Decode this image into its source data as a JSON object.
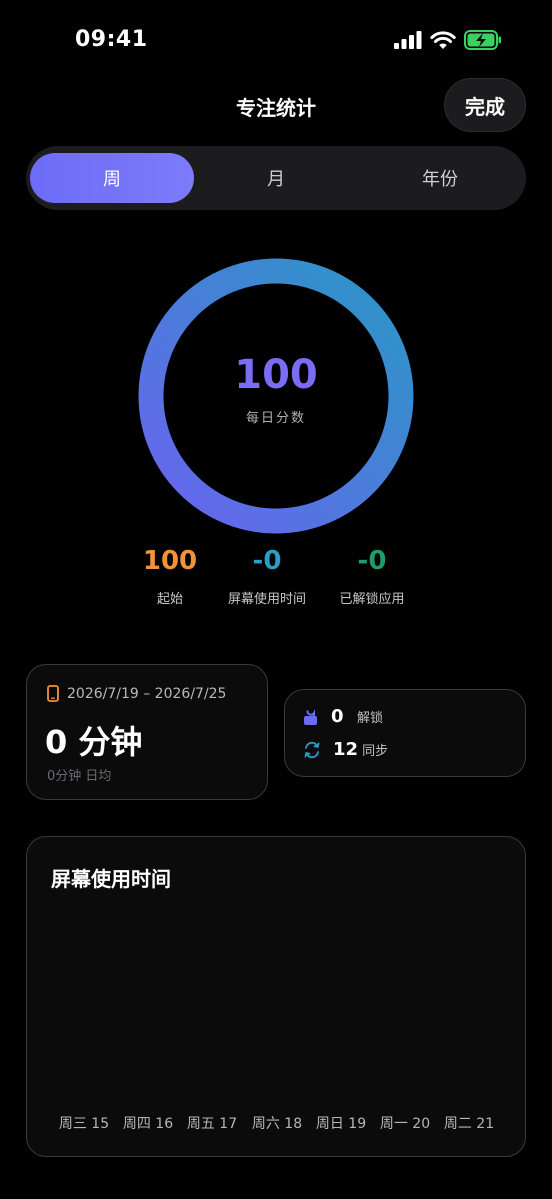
{
  "status_bar": {
    "time": "09:41"
  },
  "header": {
    "title": "专注统计",
    "done_label": "完成"
  },
  "segments": [
    "周",
    "月",
    "年份"
  ],
  "ring": {
    "score": "100",
    "label": "每日分数",
    "colors": {
      "start": "#6a63f0",
      "end": "#2a97c4"
    }
  },
  "stats": [
    {
      "value": "100",
      "label": "起始",
      "color": "#f0913b"
    },
    {
      "value": "-0",
      "label": "屏幕使用时间",
      "color": "#2b9dc6"
    },
    {
      "value": "-0",
      "label": "已解锁应用",
      "color": "#1e9c6c"
    }
  ],
  "range_card": {
    "range": "2026/7/19 – 2026/7/25",
    "total": "0 分钟",
    "average": "0分钟 日均"
  },
  "mini_card": {
    "unlocks": {
      "value": "0",
      "label": "解锁"
    },
    "syncs": {
      "value": "12",
      "label": "同步"
    }
  },
  "chart": {
    "title": "屏幕使用时间",
    "days": [
      "周三 15",
      "周四 16",
      "周五 17",
      "周六 18",
      "周日 19",
      "周一 20",
      "周二 21"
    ]
  },
  "chart_data": {
    "type": "bar",
    "title": "屏幕使用时间",
    "categories": [
      "周三 15",
      "周四 16",
      "周五 17",
      "周六 18",
      "周日 19",
      "周一 20",
      "周二 21"
    ],
    "values": [
      0,
      0,
      0,
      0,
      0,
      0,
      0
    ]
  }
}
